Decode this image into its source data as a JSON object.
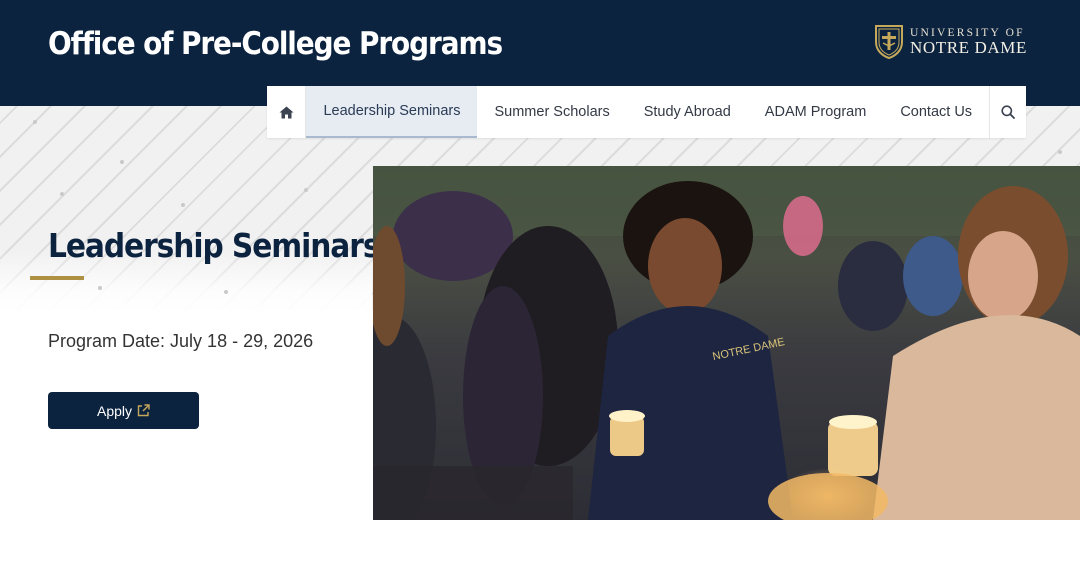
{
  "header": {
    "site_title": "Office of Pre-College Programs",
    "brand_line1": "UNIVERSITY OF",
    "brand_line2": "NOTRE DAME"
  },
  "nav": {
    "home_icon": "home-icon",
    "items": [
      {
        "label": "Leadership Seminars",
        "active": true
      },
      {
        "label": "Summer Scholars",
        "active": false
      },
      {
        "label": "Study Abroad",
        "active": false
      },
      {
        "label": "ADAM Program",
        "active": false
      },
      {
        "label": "Contact Us",
        "active": false
      }
    ],
    "search_icon": "search-icon"
  },
  "hero": {
    "title": "Leadership Seminars",
    "program_date": "Program Date: July 18 - 29, 2026",
    "apply_label": "Apply",
    "apply_icon": "external-link-icon"
  },
  "colors": {
    "navy": "#0c2340",
    "gold": "#ae9142",
    "nav_active_bg": "#e7ecf3"
  }
}
